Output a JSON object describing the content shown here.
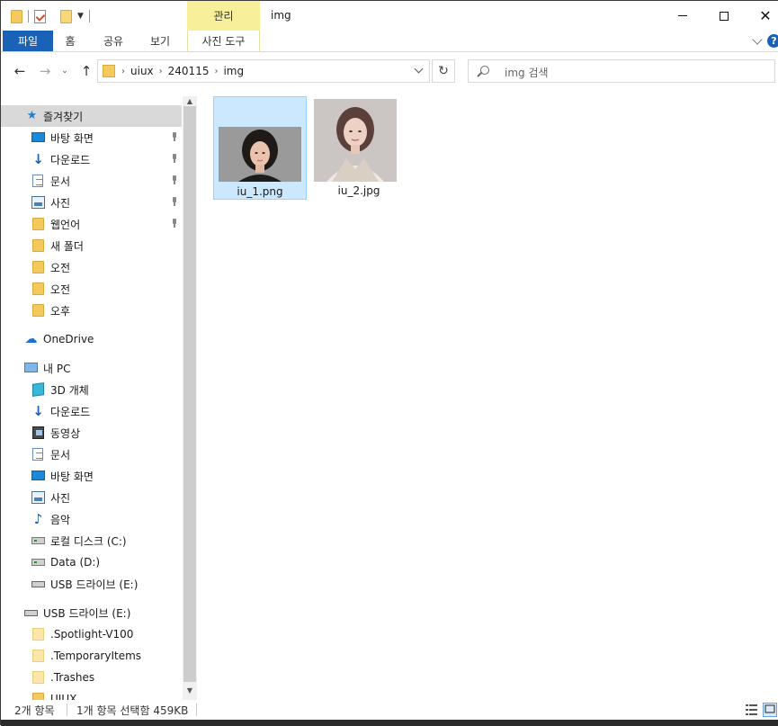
{
  "titlebar": {
    "manage_tab": "관리",
    "title": "img",
    "minimize_glyph": "",
    "maximize_glyph": "",
    "close_glyph": "✕"
  },
  "ribbon": {
    "tabs": [
      "파일",
      "홈",
      "공유",
      "보기",
      "사진 도구"
    ],
    "help_glyph": "?"
  },
  "nav": {
    "back": "←",
    "forward": "→",
    "recent": "⌄",
    "up": "↑",
    "path": [
      "uiux",
      "240115",
      "img"
    ],
    "path_sep": "›",
    "refresh": "↻"
  },
  "search": {
    "placeholder": "img 검색"
  },
  "sidebar": {
    "quick_access": "즐겨찾기",
    "quick_items": [
      "바탕 화면",
      "다운로드",
      "문서",
      "사진",
      "웹언어",
      "새 폴더",
      "오전",
      "오전",
      "오후"
    ],
    "onedrive": "OneDrive",
    "this_pc": "내 PC",
    "pc_items": [
      "3D 개체",
      "다운로드",
      "동영상",
      "문서",
      "바탕 화면",
      "사진",
      "음악",
      "로컬 디스크 (C:)",
      "Data (D:)",
      "USB 드라이브 (E:)"
    ],
    "usb": "USB 드라이브 (E:)",
    "usb_items": [
      ".Spotlight-V100",
      ".TemporaryItems",
      ".Trashes",
      "UIUX"
    ]
  },
  "files": [
    {
      "name": "iu_1.png",
      "selected": true
    },
    {
      "name": "iu_2.jpg",
      "selected": false
    }
  ],
  "status": {
    "count": "2개 항목",
    "selection": "1개 항목 선택함 459KB"
  },
  "colors": {
    "accent": "#1a62b8",
    "manage_tab": "#f7ef9a",
    "selection": "#cce8ff"
  }
}
